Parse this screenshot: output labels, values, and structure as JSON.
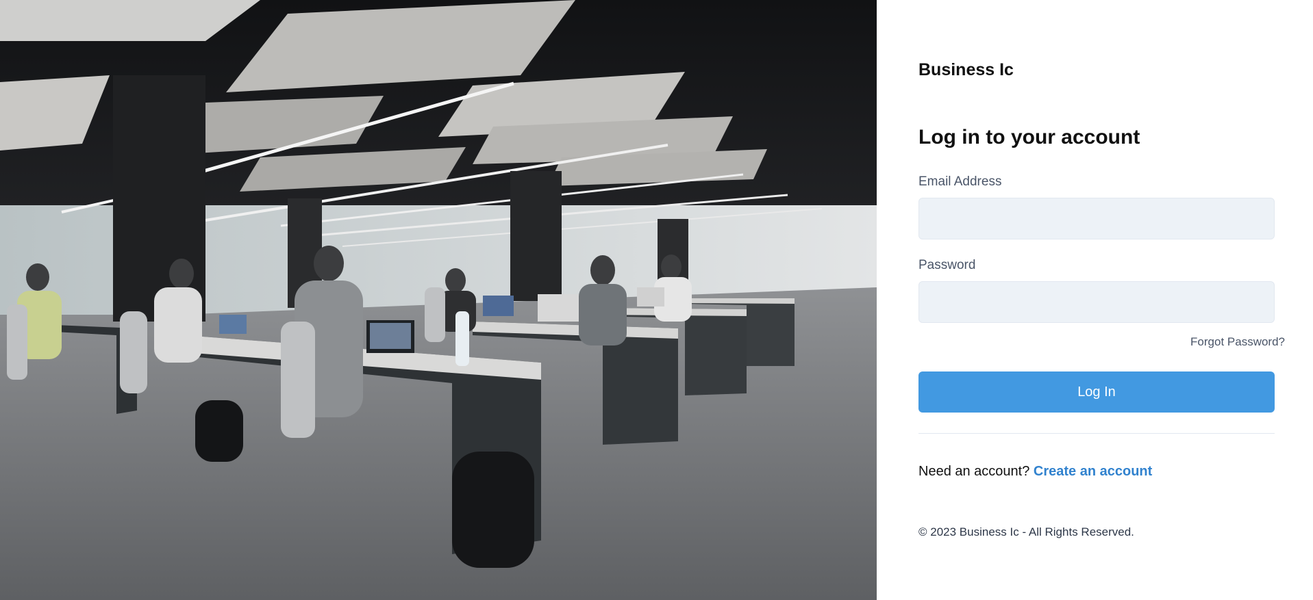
{
  "brand": {
    "name": "Business Ic"
  },
  "login": {
    "heading": "Log in to your account",
    "email_label": "Email Address",
    "email_value": "",
    "password_label": "Password",
    "password_value": "",
    "forgot_label": "Forgot Password?",
    "submit_label": "Log In"
  },
  "signup": {
    "prompt": "Need an account?",
    "link_label": "Create an account"
  },
  "footer": {
    "copyright": "© 2023 Business Ic - All Rights Reserved."
  },
  "colors": {
    "accent": "#4299e1",
    "link": "#3182ce",
    "input_bg": "#edf2f7"
  }
}
